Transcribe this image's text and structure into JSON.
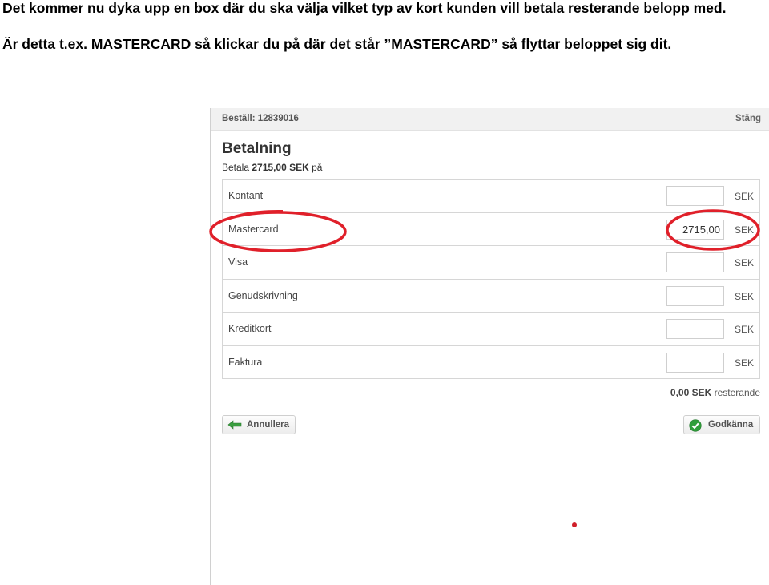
{
  "instructions": {
    "line1": "Det kommer nu dyka upp en box där du ska välja vilket typ av kort kunden vill betala resterande belopp med.",
    "line2": "Är detta t.ex. MASTERCARD så klickar du på där det står ”MASTERCARD” så flyttar beloppet sig dit."
  },
  "dialog": {
    "order_label": "Beställ: 12839016",
    "close_label": "Stäng",
    "title": "Betalning",
    "pay_prefix": "Betala",
    "pay_amount": "2715,00 SEK",
    "pay_suffix": "på",
    "methods": [
      {
        "label": "Kontant",
        "value": "",
        "currency": "SEK"
      },
      {
        "label": "Mastercard",
        "value": "2715,00",
        "currency": "SEK"
      },
      {
        "label": "Visa",
        "value": "",
        "currency": "SEK"
      },
      {
        "label": "Genudskrivning",
        "value": "",
        "currency": "SEK"
      },
      {
        "label": "Kreditkort",
        "value": "",
        "currency": "SEK"
      },
      {
        "label": "Faktura",
        "value": "",
        "currency": "SEK"
      }
    ],
    "remaining_amount": "0,00 SEK",
    "remaining_label": "resterande",
    "cancel_label": "Annullera",
    "approve_label": "Godkänna"
  },
  "colors": {
    "annotation": "#e0202a",
    "approve_icon": "#2f9e3a",
    "cancel_icon": "#3a9e3f"
  }
}
